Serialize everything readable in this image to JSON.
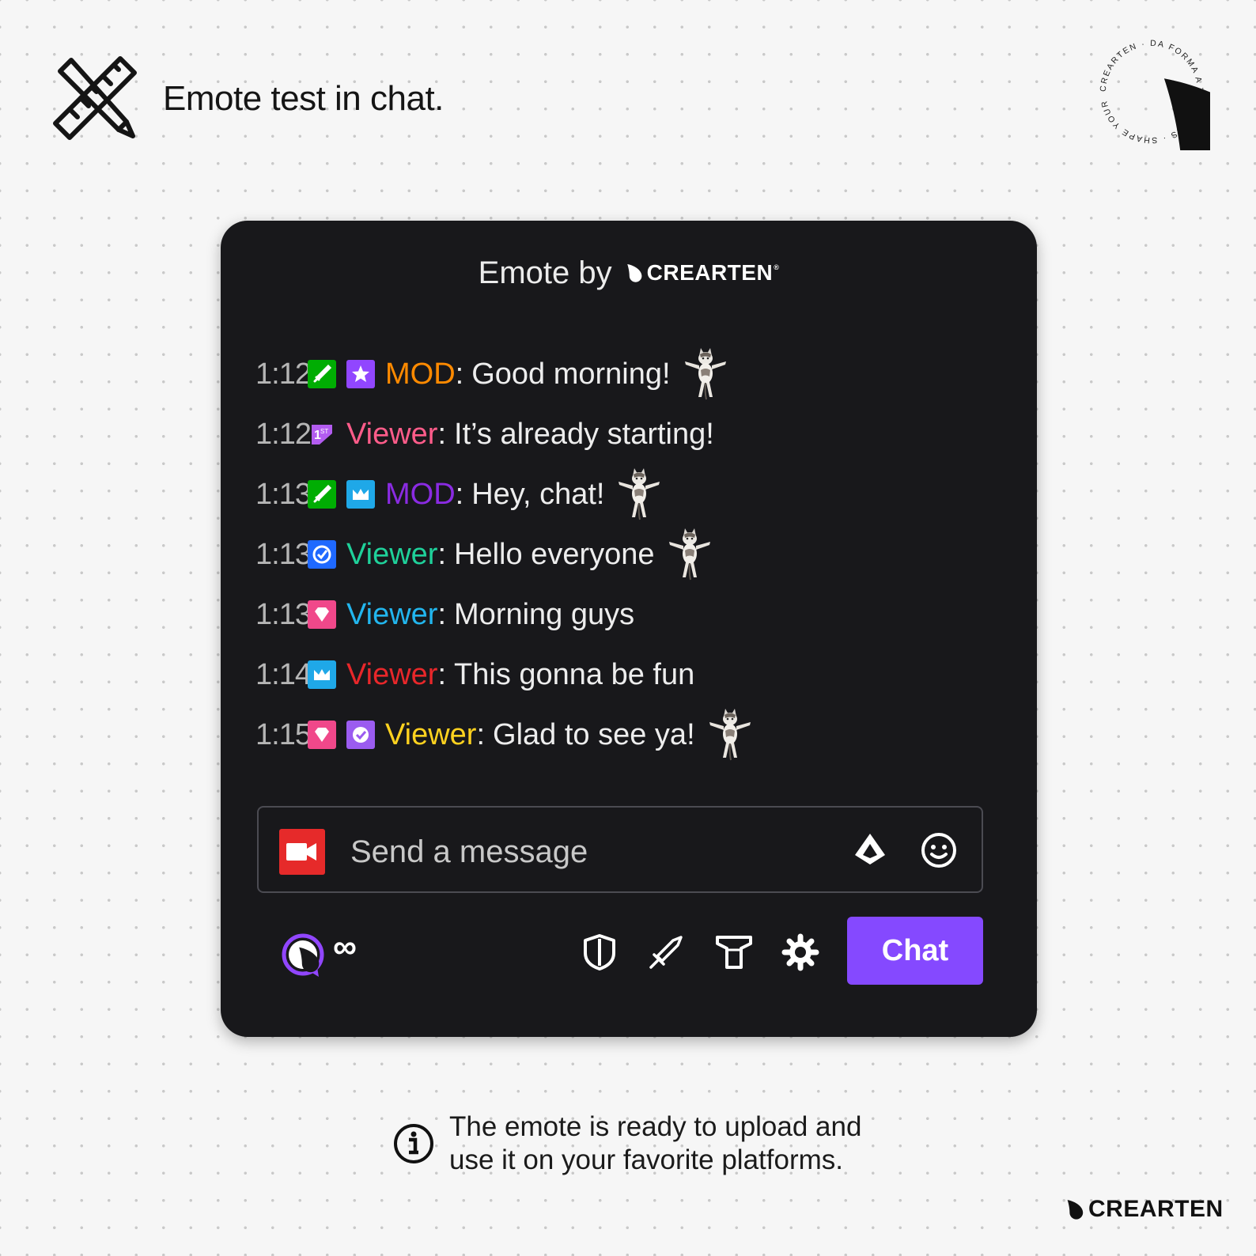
{
  "header": {
    "title": "Emote test in chat."
  },
  "seal": {
    "text": "CREARTEN · DA FORMA A TUS IDEAS · SHAPE YOUR WORLD ·"
  },
  "chat_card": {
    "title_prefix": "Emote by",
    "brand": "CREARTEN",
    "brand_reg": "®",
    "messages": [
      {
        "time": "1:12",
        "badges": [
          "sword-green",
          "star-purple"
        ],
        "user": "MOD",
        "user_color": "#ff8a00",
        "text": "Good morning!",
        "emote": true
      },
      {
        "time": "1:12",
        "badges": [
          "first-sub"
        ],
        "user": "Viewer",
        "user_color": "#ff5c8a",
        "text": "It’s already starting!",
        "emote": false
      },
      {
        "time": "1:13",
        "badges": [
          "sword-green",
          "crown-blue"
        ],
        "user": "MOD",
        "user_color": "#8a2be2",
        "text": "Hey, chat!",
        "emote": true
      },
      {
        "time": "1:13",
        "badges": [
          "verified-blue"
        ],
        "user": "Viewer",
        "user_color": "#1fd19a",
        "text": "Hello everyone",
        "emote": true
      },
      {
        "time": "1:13",
        "badges": [
          "gem-pink"
        ],
        "user": "Viewer",
        "user_color": "#22b6ee",
        "text": "Morning guys",
        "emote": false
      },
      {
        "time": "1:14",
        "badges": [
          "crown-blue"
        ],
        "user": "Viewer",
        "user_color": "#e8272a",
        "text": "This gonna be fun",
        "emote": false
      },
      {
        "time": "1:15",
        "badges": [
          "gem-pink",
          "verified-purple"
        ],
        "user": "Viewer",
        "user_color": "#ffd21f",
        "text": "Glad to see ya!",
        "emote": true
      }
    ],
    "input": {
      "placeholder": "Send a message"
    },
    "points_value": "∞",
    "chat_button": "Chat"
  },
  "info": {
    "line1": "The emote is ready to upload and",
    "line2": "use it on your favorite platforms."
  },
  "footer": {
    "brand": "CREARTEN"
  },
  "colors": {
    "card_bg": "#18181b",
    "accent_purple": "#8549ff",
    "camera_red": "#e62a2a",
    "page_bg": "#f6f6f6"
  }
}
